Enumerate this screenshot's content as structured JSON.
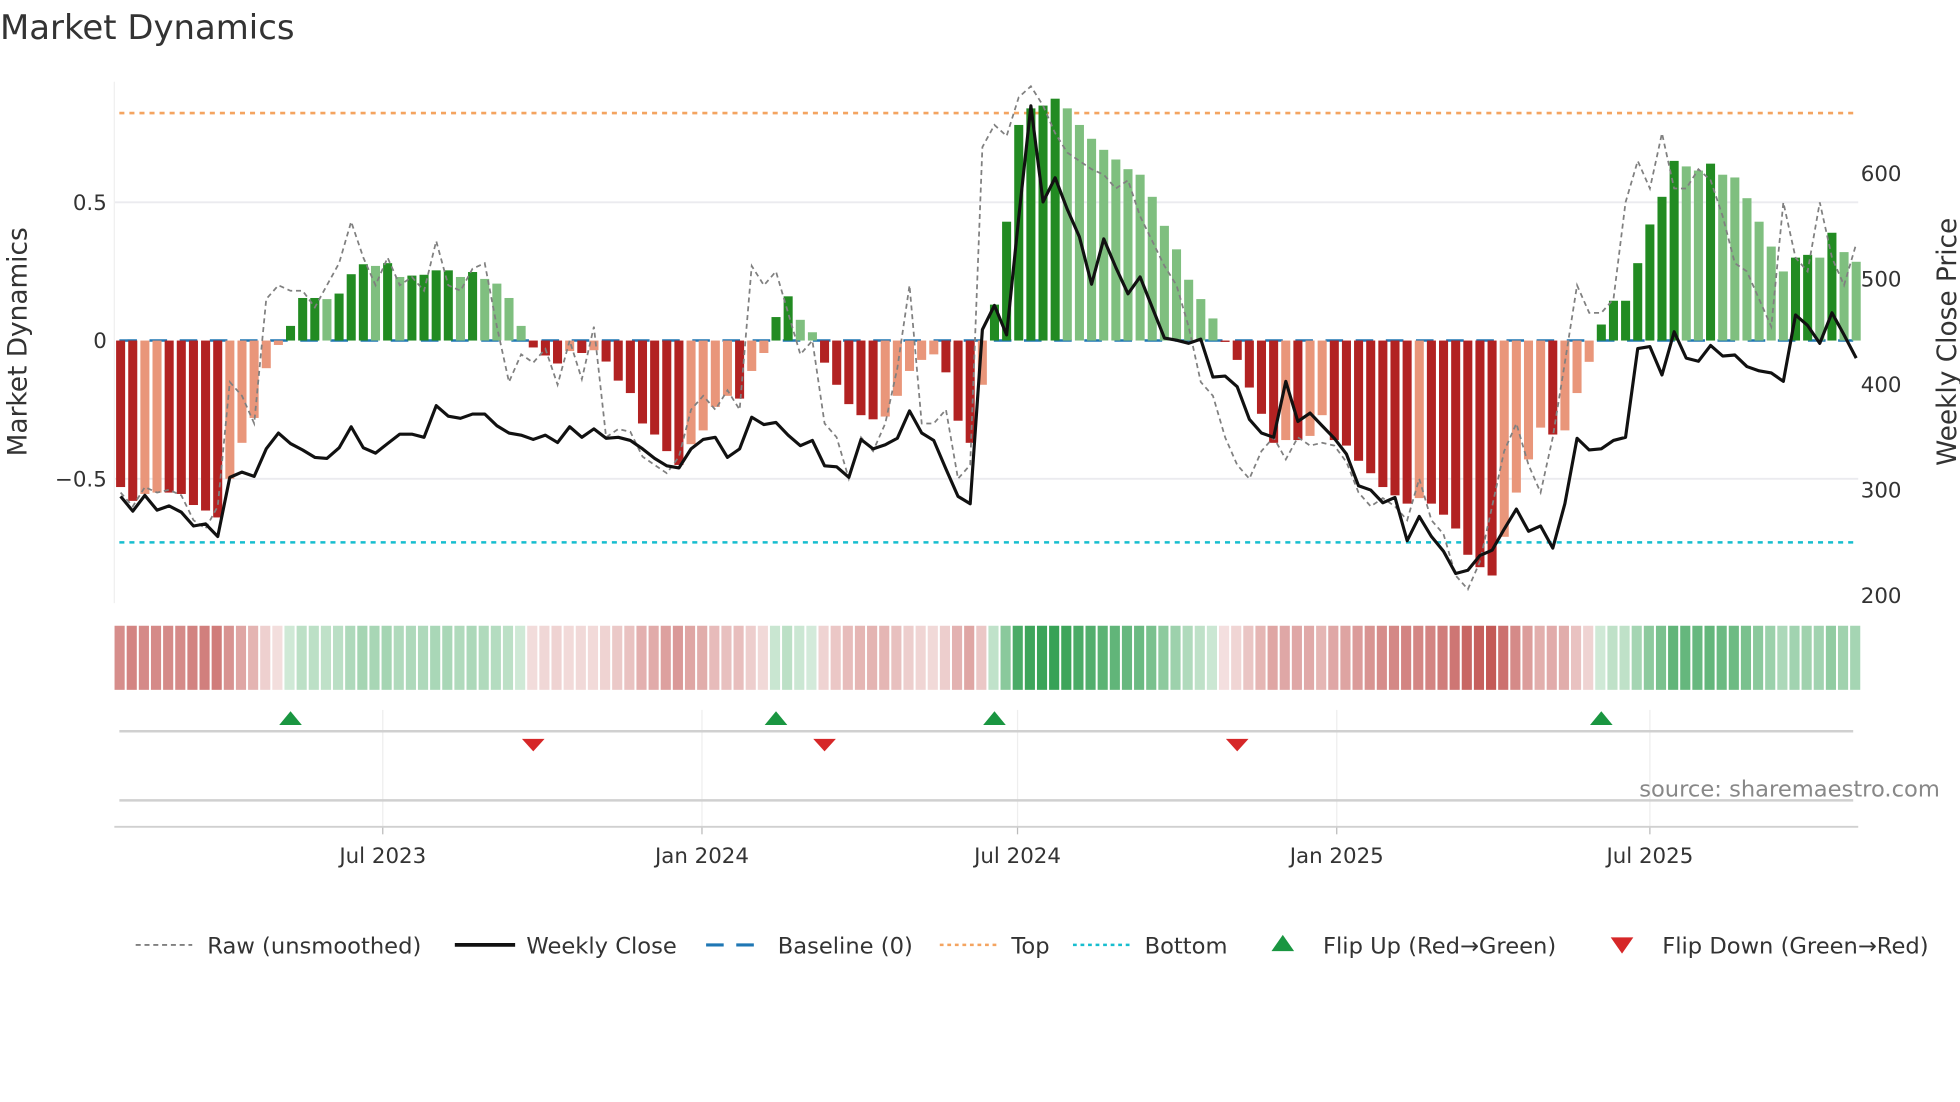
{
  "chart_data": {
    "type": "bar",
    "title": "Market Dynamics",
    "ylabel": "Market Dynamics",
    "y2label": "Weekly Close Price",
    "ylim": [
      -0.95,
      0.94
    ],
    "y2lim": [
      193,
      687
    ],
    "yticks": [
      {
        "value": 0.5,
        "label": "0.5"
      },
      {
        "value": 0,
        "label": "0"
      },
      {
        "value": -0.5,
        "label": "−0.5"
      }
    ],
    "y2ticks": [
      {
        "value": 600,
        "label": "600"
      },
      {
        "value": 500,
        "label": "500"
      },
      {
        "value": 400,
        "label": "400"
      },
      {
        "value": 300,
        "label": "300"
      },
      {
        "value": 200,
        "label": "200"
      }
    ],
    "xticks": [
      {
        "week_index": 21.6,
        "label": "Jul 2023"
      },
      {
        "week_index": 47.9,
        "label": "Jan 2024"
      },
      {
        "week_index": 73.9,
        "label": "Jul 2024"
      },
      {
        "week_index": 100.2,
        "label": "Jan 2025"
      },
      {
        "week_index": 126.0,
        "label": "Jul 2025"
      }
    ],
    "top_level": 0.823,
    "bottom_level": -0.73,
    "baseline": 0,
    "values": [
      -0.53,
      -0.58,
      -0.555,
      -0.55,
      -0.55,
      -0.555,
      -0.595,
      -0.615,
      -0.64,
      -0.5,
      -0.37,
      -0.28,
      -0.1,
      -0.016,
      0.053,
      0.154,
      0.154,
      0.15,
      0.17,
      0.24,
      0.276,
      0.27,
      0.28,
      0.23,
      0.235,
      0.238,
      0.254,
      0.254,
      0.23,
      0.248,
      0.223,
      0.206,
      0.154,
      0.053,
      -0.025,
      -0.054,
      -0.083,
      -0.038,
      -0.045,
      -0.035,
      -0.076,
      -0.145,
      -0.19,
      -0.3,
      -0.34,
      -0.4,
      -0.45,
      -0.375,
      -0.325,
      -0.24,
      -0.2,
      -0.21,
      -0.11,
      -0.045,
      0.085,
      0.16,
      0.075,
      0.03,
      -0.08,
      -0.16,
      -0.23,
      -0.27,
      -0.285,
      -0.275,
      -0.2,
      -0.11,
      -0.07,
      -0.05,
      -0.115,
      -0.29,
      -0.37,
      -0.16,
      0.13,
      0.43,
      0.78,
      0.84,
      0.85,
      0.875,
      0.84,
      0.78,
      0.73,
      0.69,
      0.655,
      0.62,
      0.6,
      0.52,
      0.415,
      0.33,
      0.22,
      0.15,
      0.08,
      -0.005,
      -0.07,
      -0.17,
      -0.265,
      -0.37,
      -0.36,
      -0.36,
      -0.345,
      -0.27,
      -0.36,
      -0.38,
      -0.435,
      -0.48,
      -0.53,
      -0.56,
      -0.59,
      -0.57,
      -0.59,
      -0.63,
      -0.68,
      -0.775,
      -0.82,
      -0.85,
      -0.71,
      -0.55,
      -0.43,
      -0.315,
      -0.34,
      -0.325,
      -0.19,
      -0.077,
      0.058,
      0.144,
      0.144,
      0.28,
      0.42,
      0.52,
      0.65,
      0.63,
      0.615,
      0.64,
      0.6,
      0.59,
      0.515,
      0.43,
      0.34,
      0.25,
      0.3,
      0.31,
      0.3,
      0.39,
      0.32,
      0.285
    ],
    "raw": [
      -0.55,
      -0.6,
      -0.53,
      -0.55,
      -0.54,
      -0.56,
      -0.65,
      -0.68,
      -0.6,
      -0.15,
      -0.2,
      -0.3,
      0.15,
      0.2,
      0.18,
      0.18,
      0.12,
      0.2,
      0.28,
      0.43,
      0.3,
      0.2,
      0.3,
      0.2,
      0.23,
      0.18,
      0.36,
      0.2,
      0.18,
      0.26,
      0.28,
      0.05,
      -0.15,
      -0.05,
      -0.08,
      -0.03,
      -0.16,
      0.0,
      -0.14,
      0.05,
      -0.35,
      -0.32,
      -0.33,
      -0.42,
      -0.45,
      -0.48,
      -0.42,
      -0.25,
      -0.2,
      -0.25,
      -0.18,
      -0.25,
      0.27,
      0.2,
      0.25,
      0.1,
      -0.05,
      0.0,
      -0.3,
      -0.35,
      -0.5,
      -0.35,
      -0.4,
      -0.3,
      -0.1,
      0.2,
      -0.3,
      -0.3,
      -0.25,
      -0.5,
      -0.45,
      0.7,
      0.78,
      0.74,
      0.88,
      0.92,
      0.85,
      0.75,
      0.68,
      0.65,
      0.62,
      0.6,
      0.55,
      0.58,
      0.45,
      0.36,
      0.27,
      0.2,
      0.05,
      -0.15,
      -0.2,
      -0.35,
      -0.45,
      -0.5,
      -0.4,
      -0.35,
      -0.43,
      -0.35,
      -0.38,
      -0.37,
      -0.38,
      -0.44,
      -0.55,
      -0.6,
      -0.57,
      -0.6,
      -0.65,
      -0.5,
      -0.65,
      -0.7,
      -0.85,
      -0.9,
      -0.8,
      -0.6,
      -0.4,
      -0.3,
      -0.45,
      -0.55,
      -0.35,
      -0.08,
      0.2,
      0.1,
      0.1,
      0.15,
      0.5,
      0.65,
      0.55,
      0.75,
      0.55,
      0.55,
      0.62,
      0.58,
      0.45,
      0.28,
      0.25,
      0.15,
      0.05,
      0.5,
      0.3,
      0.25,
      0.5,
      0.3,
      0.2,
      0.35
    ],
    "weekly_close": [
      294,
      280,
      295,
      281,
      285,
      279,
      266,
      268,
      256,
      312,
      317,
      313,
      339,
      354,
      344,
      338,
      331,
      330,
      340,
      360,
      340,
      335,
      344,
      353,
      353,
      350,
      380,
      370,
      368,
      372,
      372,
      361,
      354,
      352,
      348,
      352,
      345,
      360,
      350,
      358,
      349,
      350,
      347,
      339,
      330,
      323,
      321,
      339,
      348,
      350,
      331,
      339,
      369,
      362,
      364,
      352,
      342,
      347,
      323,
      322,
      312,
      348,
      339,
      343,
      349,
      375,
      354,
      347,
      320,
      294,
      287,
      452,
      475,
      447,
      558,
      664,
      573,
      596,
      566,
      540,
      495,
      538,
      511,
      486,
      502,
      473,
      444,
      442,
      439,
      443,
      407,
      408,
      398,
      367,
      354,
      350,
      403,
      365,
      373,
      361,
      349,
      334,
      304,
      300,
      288,
      293,
      252,
      275,
      256,
      242,
      221,
      224,
      238,
      243,
      263,
      282,
      261,
      266,
      245,
      287,
      349,
      338,
      339,
      347,
      350,
      434,
      436,
      409,
      450,
      425,
      422,
      437,
      427,
      428,
      417,
      413,
      411,
      403,
      466,
      456,
      439,
      468,
      447,
      425
    ],
    "flip_up_indices": [
      14,
      54,
      72,
      122
    ],
    "flip_down_indices": [
      34,
      58,
      92
    ],
    "legend": [
      {
        "key": "raw",
        "label": "Raw (unsmoothed)"
      },
      {
        "key": "close",
        "label": "Weekly Close"
      },
      {
        "key": "baseline",
        "label": "Baseline (0)"
      },
      {
        "key": "top",
        "label": "Top"
      },
      {
        "key": "bottom",
        "label": "Bottom"
      },
      {
        "key": "flip_up",
        "label": "Flip Up (Red→Green)"
      },
      {
        "key": "flip_down",
        "label": "Flip Down (Green→Red)"
      }
    ],
    "legend_placement": "bottom",
    "source": "source: sharemaestro.com",
    "colors": {
      "neg_strong": "#b22222",
      "neg_weak": "#e9967a",
      "pos_strong": "#228b22",
      "pos_weak": "#7fbf7f",
      "top": "#f4a460",
      "bottom": "#17becf",
      "baseline": "#1f77b4",
      "close": "#111111",
      "raw": "#808080",
      "flip_up": "#1a9641",
      "flip_down": "#d62728"
    }
  }
}
